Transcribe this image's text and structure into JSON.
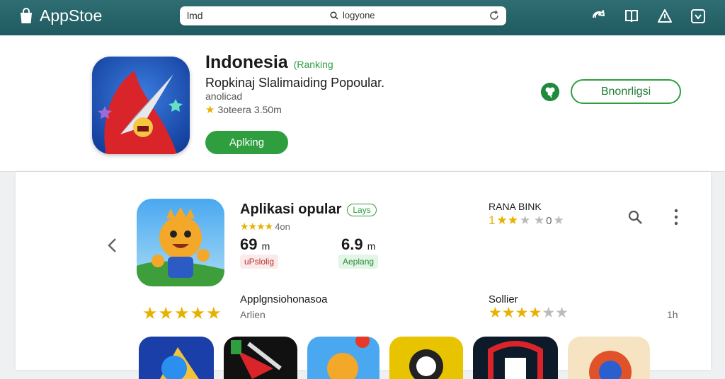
{
  "topbar": {
    "brand": "AppStoe",
    "search_left": "lmd",
    "search_query": "logyone",
    "icons": [
      "share-icon",
      "book-icon",
      "alert-icon",
      "download-icon"
    ]
  },
  "hero": {
    "title": "Indonesia",
    "tag": "(Ranking",
    "subtitle": "Ropkinaj Slalimaiding Popoular.",
    "developer": "anolicad",
    "rating_text": "3oteera 3.50m",
    "primary_button": "Aplking",
    "secondary_button": "Bnonrligsi"
  },
  "featured": {
    "title": "Aplikasi opular",
    "badge": "Lays",
    "rating_text": "4on",
    "stat1_value": "69",
    "stat1_unit": "m",
    "stat2_value": "6.9",
    "stat2_unit": "m",
    "chip_red": "uPslolig",
    "chip_green": "Aeplang",
    "rank_heading": "RANA BINK",
    "rank_prefix": "1",
    "rank_value": "0"
  },
  "section2": {
    "title": "Applgnsiohonasoa",
    "subtitle": "Arlien",
    "star_count": 5
  },
  "section3": {
    "title": "Sollier",
    "count": "1h"
  },
  "colors": {
    "topbar": "#2f6e73",
    "accent_green": "#2e9e3e",
    "star": "#e8b100"
  }
}
